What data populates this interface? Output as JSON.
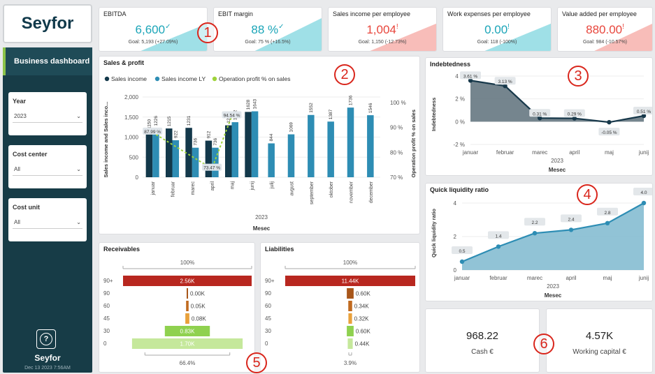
{
  "logo": {
    "text": "Seyfor"
  },
  "sidebar": {
    "title": "Business dashboard",
    "filters": [
      {
        "label": "Year",
        "value": "2023"
      },
      {
        "label": "Cost center",
        "value": "All"
      },
      {
        "label": "Cost unit",
        "value": "All"
      }
    ],
    "help_label": "?",
    "brand": "Seyfor",
    "timestamp": "Dec 13 2023 7:56AM"
  },
  "kpis": [
    {
      "title": "EBITDA",
      "value": "6,600",
      "mark": "✓",
      "goal": "Goal: 5,193 (+27.09%)",
      "color": "#1ba5b8",
      "area": "#7fd6df"
    },
    {
      "title": "EBIT margin",
      "value": "88 %",
      "mark": "✓",
      "goal": "Goal: 75 % (+16.5%)",
      "color": "#1ba5b8",
      "area": "#7fd6df"
    },
    {
      "title": "Sales income per employee",
      "value": "1,004",
      "mark": "!",
      "goal": "Goal: 1,150 (-12.73%)",
      "color": "#e8463c",
      "area": "#f6a7a1"
    },
    {
      "title": "Work expenses per employee",
      "value": "0.00",
      "mark": "!",
      "goal": "Goal: 118 (-100%)",
      "color": "#1ba5b8",
      "area": "#7fd6df"
    },
    {
      "title": "Value added per employee",
      "value": "880.00",
      "mark": "!",
      "goal": "Goal: 984 (-10.57%)",
      "color": "#e8463c",
      "area": "#f6a7a1"
    }
  ],
  "callouts": [
    "1",
    "2",
    "3",
    "4",
    "5",
    "6"
  ],
  "sales": {
    "title": "Sales & profit",
    "legend": [
      "Sales income",
      "Sales income LY",
      "Operation profit % on sales"
    ],
    "y_ticks": [
      "2,000",
      "1,500",
      "1,000",
      "500",
      "0"
    ],
    "y2_ticks": [
      "100 %",
      "90 %",
      "80 %",
      "70 %"
    ],
    "ylabel": "Sales income and Sales inco...",
    "y2label": "Operation profit % on sales",
    "xyear": "2023",
    "xlabel": "Mesec"
  },
  "indebt": {
    "title": "Indebtedness",
    "y_ticks": [
      "4 %",
      "2 %",
      "0 %",
      "-2 %"
    ],
    "ylabel": "Indebtedness",
    "xyear": "2023",
    "xlabel": "Mesec"
  },
  "quick": {
    "title": "Quick liquidity ratio",
    "y_ticks": [
      "4",
      "2",
      "0"
    ],
    "ylabel": "Quick liquidity ratio",
    "xyear": "2023",
    "xlabel": "Mesec"
  },
  "receivables": {
    "title": "Receivables",
    "top": "100%",
    "bottom": "66.4%",
    "rows": [
      {
        "cat": "90+",
        "label": "2.56K",
        "value": 2.56,
        "color": "#b8271f"
      },
      {
        "cat": "90",
        "label": "0.00K",
        "value": 0,
        "color": "#a8561a"
      },
      {
        "cat": "60",
        "label": "0.05K",
        "value": 0.05,
        "color": "#c06a1f"
      },
      {
        "cat": "45",
        "label": "0.08K",
        "value": 0.08,
        "color": "#e9a13b"
      },
      {
        "cat": "30",
        "label": "0.83K",
        "value": 0.83,
        "color": "#8fd14f"
      },
      {
        "cat": "0",
        "label": "1.70K",
        "value": 1.7,
        "color": "#c5e89b"
      }
    ]
  },
  "liabilities": {
    "title": "Liabilities",
    "top": "100%",
    "bottom": "3.9%",
    "rows": [
      {
        "cat": "90+",
        "label": "11.44K",
        "value": 11.44,
        "color": "#b8271f"
      },
      {
        "cat": "90",
        "label": "0.60K",
        "value": 0.6,
        "color": "#a8561a"
      },
      {
        "cat": "60",
        "label": "0.34K",
        "value": 0.34,
        "color": "#c06a1f"
      },
      {
        "cat": "45",
        "label": "0.32K",
        "value": 0.32,
        "color": "#e9a13b"
      },
      {
        "cat": "30",
        "label": "0.60K",
        "value": 0.6,
        "color": "#8fd14f"
      },
      {
        "cat": "0",
        "label": "0.44K",
        "value": 0.44,
        "color": "#c5e89b"
      }
    ]
  },
  "cards": [
    {
      "value": "968.22",
      "label": "Cash €"
    },
    {
      "value": "4.57K",
      "label": "Working capital €"
    }
  ],
  "chart_data": [
    {
      "type": "bar",
      "title": "Sales & profit",
      "xlabel": "Mesec",
      "ylabel": "Sales income and Sales inco...",
      "ylim": [
        0,
        2000
      ],
      "categories": [
        "januar",
        "februar",
        "marec",
        "april",
        "maj",
        "junij",
        "julij",
        "avgust",
        "september",
        "oktober",
        "november",
        "december"
      ],
      "series": [
        {
          "name": "Sales income",
          "color": "#13384a",
          "values": [
            1150,
            1215,
            1231,
            912,
            1294,
            1628,
            null,
            null,
            null,
            null,
            null,
            null
          ]
        },
        {
          "name": "Sales income LY",
          "color": "#2e8db4",
          "values": [
            1226,
            922,
            736,
            736,
            1372,
            1643,
            844,
            1069,
            1552,
            1387,
            1736,
            1546
          ]
        },
        {
          "name": "Operation profit % on sales",
          "color": "#9ed33a",
          "axis": "y2",
          "values": [
            87.99,
            null,
            null,
            73.47,
            94.54,
            null,
            null,
            null,
            null,
            null,
            null,
            null
          ]
        }
      ],
      "y2lim": [
        70,
        100
      ]
    },
    {
      "type": "area",
      "title": "Indebtedness",
      "xlabel": "Mesec",
      "ylabel": "Indebtedness",
      "ylim": [
        -2,
        4
      ],
      "categories": [
        "januar",
        "februar",
        "marec",
        "april",
        "maj",
        "junij"
      ],
      "values": [
        3.61,
        3.13,
        0.31,
        0.29,
        -0.05,
        0.51
      ],
      "labels": [
        "3.61 %",
        "3.13 %",
        "0.31 %",
        "0.29 %",
        "-0.05 %",
        "0.51 %"
      ]
    },
    {
      "type": "area",
      "title": "Quick liquidity ratio",
      "xlabel": "Mesec",
      "ylabel": "Quick liquidity ratio",
      "ylim": [
        0,
        4
      ],
      "categories": [
        "januar",
        "februar",
        "marec",
        "april",
        "maj",
        "junij"
      ],
      "values": [
        0.5,
        1.4,
        2.2,
        2.4,
        2.8,
        4.0
      ],
      "labels": [
        "0.5",
        "1.4",
        "2.2",
        "2.4",
        "2.8",
        "4.0"
      ]
    }
  ]
}
